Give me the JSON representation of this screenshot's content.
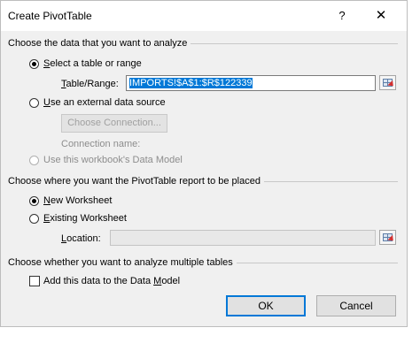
{
  "window": {
    "title": "Create PivotTable",
    "help_glyph": "?",
    "close_glyph": "✕"
  },
  "section_data": {
    "heading": "Choose the data that you want to analyze",
    "select_table_label_u": "S",
    "select_table_label_rest": "elect a table or range",
    "select_table_checked": true,
    "table_range_label_u": "T",
    "table_range_label_rest": "able/Range:",
    "table_range_value": "IMPORTS!$A$1:$R$122339",
    "external_label_u": "U",
    "external_label_rest": "se an external data source",
    "choose_connection_label": "Choose Connection...",
    "connection_name_label": "Connection name:",
    "data_model_label": "Use this workbook's Data Model"
  },
  "section_place": {
    "heading": "Choose where you want the PivotTable report to be placed",
    "new_ws_label_u": "N",
    "new_ws_label_rest": "ew Worksheet",
    "new_ws_checked": true,
    "existing_ws_label_u": "E",
    "existing_ws_label_rest": "xisting Worksheet",
    "location_label_u": "L",
    "location_label_rest": "ocation:",
    "location_value": ""
  },
  "section_multi": {
    "heading": "Choose whether you want to analyze multiple tables",
    "add_model_label_pre": "Add this data to the Data ",
    "add_model_label_u": "M",
    "add_model_label_post": "odel",
    "add_model_checked": false
  },
  "buttons": {
    "ok": "OK",
    "cancel": "Cancel"
  },
  "colors": {
    "dialog_bg": "#f0f0f0",
    "selection": "#0078d7",
    "disabled_text": "#8d8d8d"
  }
}
